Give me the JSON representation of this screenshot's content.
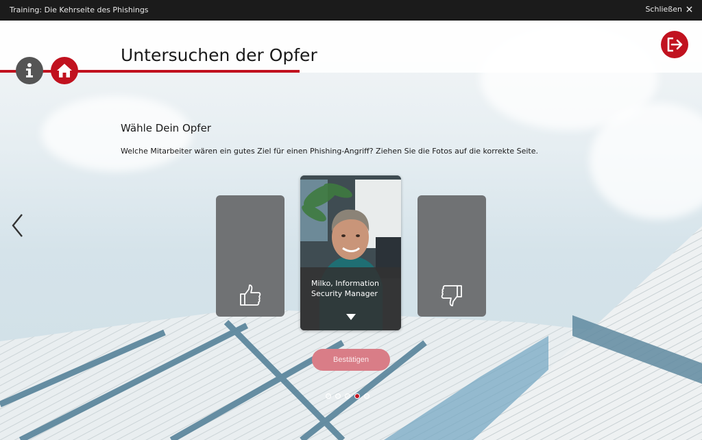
{
  "window": {
    "title": "Training: Die Kehrseite des Phishings",
    "close_label": "Schließen"
  },
  "header": {
    "page_title": "Untersuchen der Opfer"
  },
  "content": {
    "subtitle": "Wähle Dein Opfer",
    "instruction": "Welche Mitarbeiter wären ein gutes Ziel für einen Phishing-Angriff? Ziehen Sie die Fotos auf die korrekte Seite.",
    "card": {
      "name": "Milko, Information Security Manager"
    },
    "confirm_label": "Bestätigen"
  },
  "pagination": {
    "total": 5,
    "current": 4
  },
  "icons": {
    "info": "info-icon",
    "home": "home-icon",
    "exit": "exit-icon",
    "prev": "chevron-left-icon",
    "like": "thumbs-up-icon",
    "dislike": "thumbs-down-icon",
    "expand": "caret-down-icon",
    "close": "close-icon"
  },
  "colors": {
    "accent": "#c1121f",
    "topbar": "#1b1b1b",
    "dropzone": "#707274",
    "confirm_disabled": "#d97d87"
  }
}
